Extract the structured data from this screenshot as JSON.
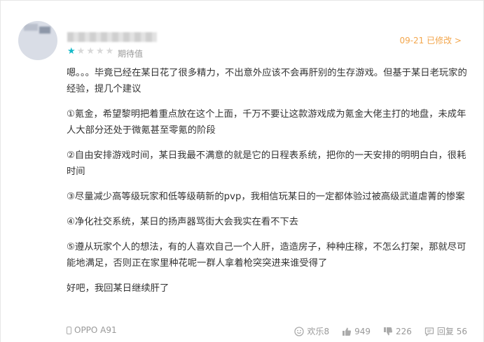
{
  "review": {
    "edited_time": "09-21 已修改 >",
    "rating_label": "期待值",
    "rating": 1,
    "rating_max": 5,
    "paragraphs": [
      "嗯。。。毕竟已经在某日花了很多精力，不出意外应该不会再肝别的生存游戏。但基于某日老玩家的经验，提几个建议",
      "①氪金，希望黎明把着重点放在这个上面，千万不要让这款游戏成为氪金大佬主打的地盘，未成年人大部分还处于微氪甚至零氪的阶段",
      "②自由安排游戏时间，某日我最不满意的就是它的日程表系统，把你的一天安排的明明白白，很耗时间",
      "③尽量减少高等级玩家和低等级萌新的pvp，我相信玩某日的一定都体验过被高级武道虐菁的惨案",
      "④净化社交系统，某日的扬声器骂街大会我实在看不下去",
      "⑤遵从玩家个人的想法，有的人喜欢自己一个人肝，造造房子，种种庄稼，不怎么打架，那就尽可能地满足，否则正在家里种花呢一群人拿着枪突突进来谁受得了",
      "好吧，我回某日继续肝了"
    ]
  },
  "footer": {
    "device": "OPPO A91",
    "fun_label": "欢乐8",
    "likes": "949",
    "dislikes": "226",
    "replies": "回复 56"
  },
  "colors": {
    "accent_teal": "#14b9c8",
    "edit_orange": "#f3a64c",
    "muted_text": "#999999",
    "body_text": "#333333"
  },
  "icons": [
    "star-icon",
    "phone-icon",
    "smile-icon",
    "thumbs-up-icon",
    "thumbs-down-icon",
    "reply-icon"
  ]
}
